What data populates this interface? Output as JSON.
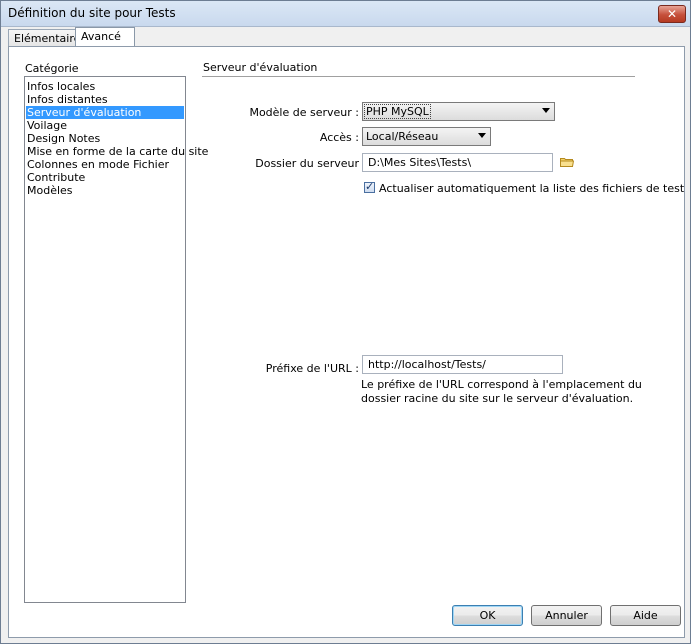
{
  "window": {
    "title": "Définition du site pour Tests",
    "close_label": "✕"
  },
  "tabs": [
    {
      "label": "Elémentaire"
    },
    {
      "label": "Avancé"
    }
  ],
  "category": {
    "label": "Catégorie",
    "items": [
      "Infos locales",
      "Infos distantes",
      "Serveur d'évaluation",
      "Voilage",
      "Design Notes",
      "Mise en forme de la carte du site",
      "Colonnes en mode Fichier",
      "Contribute",
      "Modèles"
    ],
    "selected_index": 2
  },
  "section": {
    "title": "Serveur d'évaluation"
  },
  "form": {
    "server_model_label": "Modèle de serveur :",
    "server_model_value": "PHP MySQL",
    "access_label": "Accès :",
    "access_value": "Local/Réseau",
    "server_folder_label": "Dossier du serveur",
    "server_folder_value": "D:\\Mes Sites\\Tests\\",
    "auto_refresh_label": "Actualiser automatiquement la liste des fichiers de test",
    "auto_refresh_checked": true,
    "url_prefix_label": "Préfixe de l'URL :",
    "url_prefix_value": "http://localhost/Tests/",
    "url_help_line1": "Le préfixe de l'URL correspond à l'emplacement du",
    "url_help_line2": "dossier racine du site sur le serveur d'évaluation."
  },
  "buttons": {
    "ok": "OK",
    "cancel": "Annuler",
    "help": "Aide"
  },
  "icons": {
    "folder": "folder-icon",
    "close": "close-icon",
    "dropdown": "chevron-down-icon"
  }
}
